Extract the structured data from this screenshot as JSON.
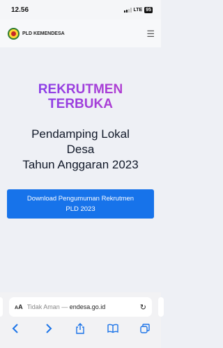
{
  "status_bar": {
    "time": "12.56",
    "network": "LTE",
    "battery": "95"
  },
  "header": {
    "brand_name": "PLD KEMENDESA",
    "menu_icon": "hamburger-icon"
  },
  "hero": {
    "kicker_line1": "REKRUTMEN",
    "kicker_line2": "TERBUKA",
    "title_line1": "Pendamping Lokal",
    "title_line2": "Desa",
    "title_line3": "Tahun Anggaran 2023",
    "cta_line1": "Download Pengumuman Rekrutmen",
    "cta_line2": "PLD 2023"
  },
  "browser": {
    "aa_label": "A",
    "aa_label_big": "A",
    "url_prefix": "Tidak Aman — ",
    "url_domain": "endesa.go.id",
    "reload_icon": "reload-icon"
  },
  "colors": {
    "accent": "#1773ea",
    "kicker_start": "#7a3ff2",
    "kicker_end": "#c13ec7"
  }
}
